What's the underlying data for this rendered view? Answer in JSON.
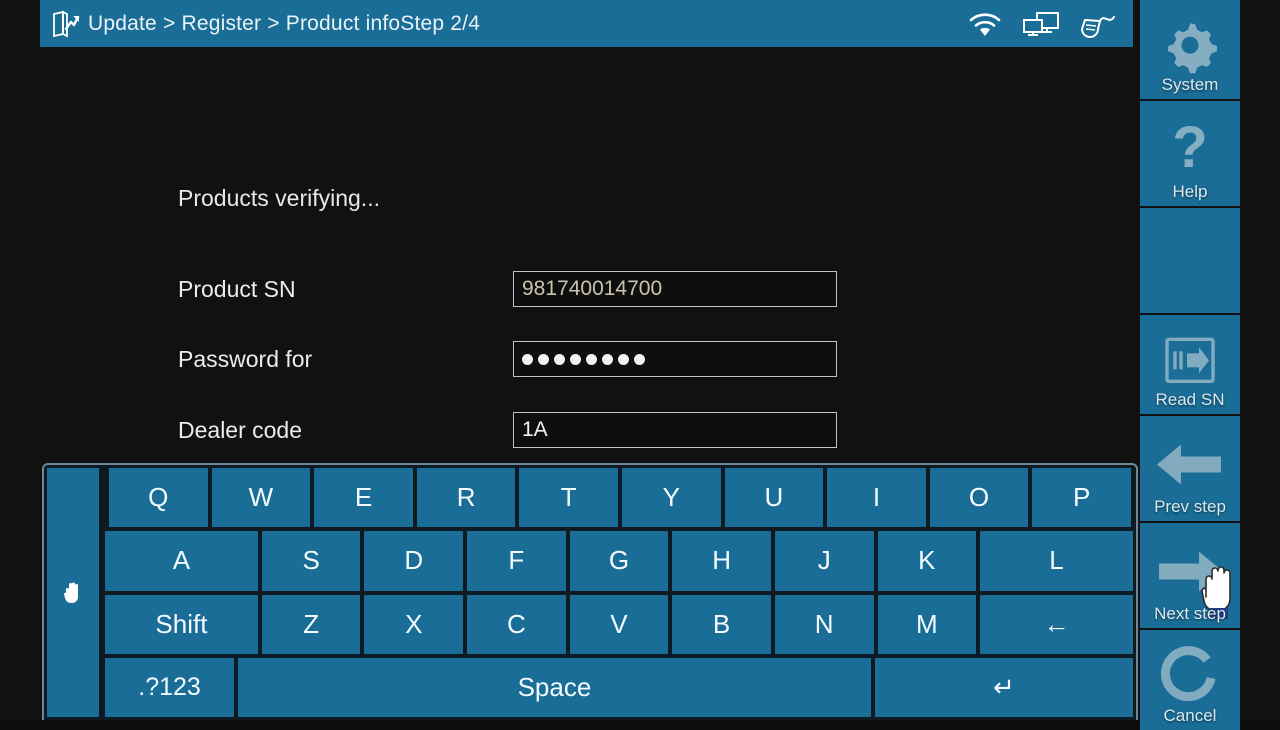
{
  "titlebar": {
    "app_icon": "document-chart-icon",
    "breadcrumb": "Update > Register > Product infoStep 2/4",
    "status_icons": [
      {
        "name": "wifi-icon",
        "label": "wifi"
      },
      {
        "name": "network-monitors-icon",
        "label": "network"
      },
      {
        "name": "obd-connector-icon",
        "label": "connector"
      }
    ],
    "bg_color": "#1a6d96"
  },
  "main": {
    "status_text": "Products verifying...",
    "fields": [
      {
        "label": "Product SN",
        "value": "981740014700",
        "type": "text",
        "name": "product-sn"
      },
      {
        "label": "Password for",
        "value": "",
        "type": "password",
        "name": "password-for",
        "dots": 8
      },
      {
        "label": "Dealer code",
        "value": "1A",
        "type": "text",
        "name": "dealer-code"
      }
    ]
  },
  "sidebar": {
    "items": [
      {
        "label": "System",
        "icon": "gear-icon"
      },
      {
        "label": "Help",
        "icon": "question-mark-icon"
      },
      {
        "label": "",
        "icon": ""
      },
      {
        "label": "Read SN",
        "icon": "read-sn-arrow-icon"
      },
      {
        "label": "Prev step",
        "icon": "arrow-left-icon"
      },
      {
        "label": "Next step",
        "icon": "arrow-right-icon"
      },
      {
        "label": "Cancel",
        "icon": "refresh-c-icon"
      }
    ]
  },
  "keyboard": {
    "handle_icon": "hand-drag-icon",
    "row1": [
      "Q",
      "W",
      "E",
      "R",
      "T",
      "Y",
      "U",
      "I",
      "O",
      "P"
    ],
    "row2": [
      "A",
      "S",
      "D",
      "F",
      "G",
      "H",
      "J",
      "K",
      "L"
    ],
    "row3": [
      "Shift",
      "Z",
      "X",
      "C",
      "V",
      "B",
      "N",
      "M",
      "←"
    ],
    "row4": [
      ".?123",
      "Space",
      "↵"
    ]
  },
  "cursor": {
    "type": "hand-pointer-cursor"
  }
}
